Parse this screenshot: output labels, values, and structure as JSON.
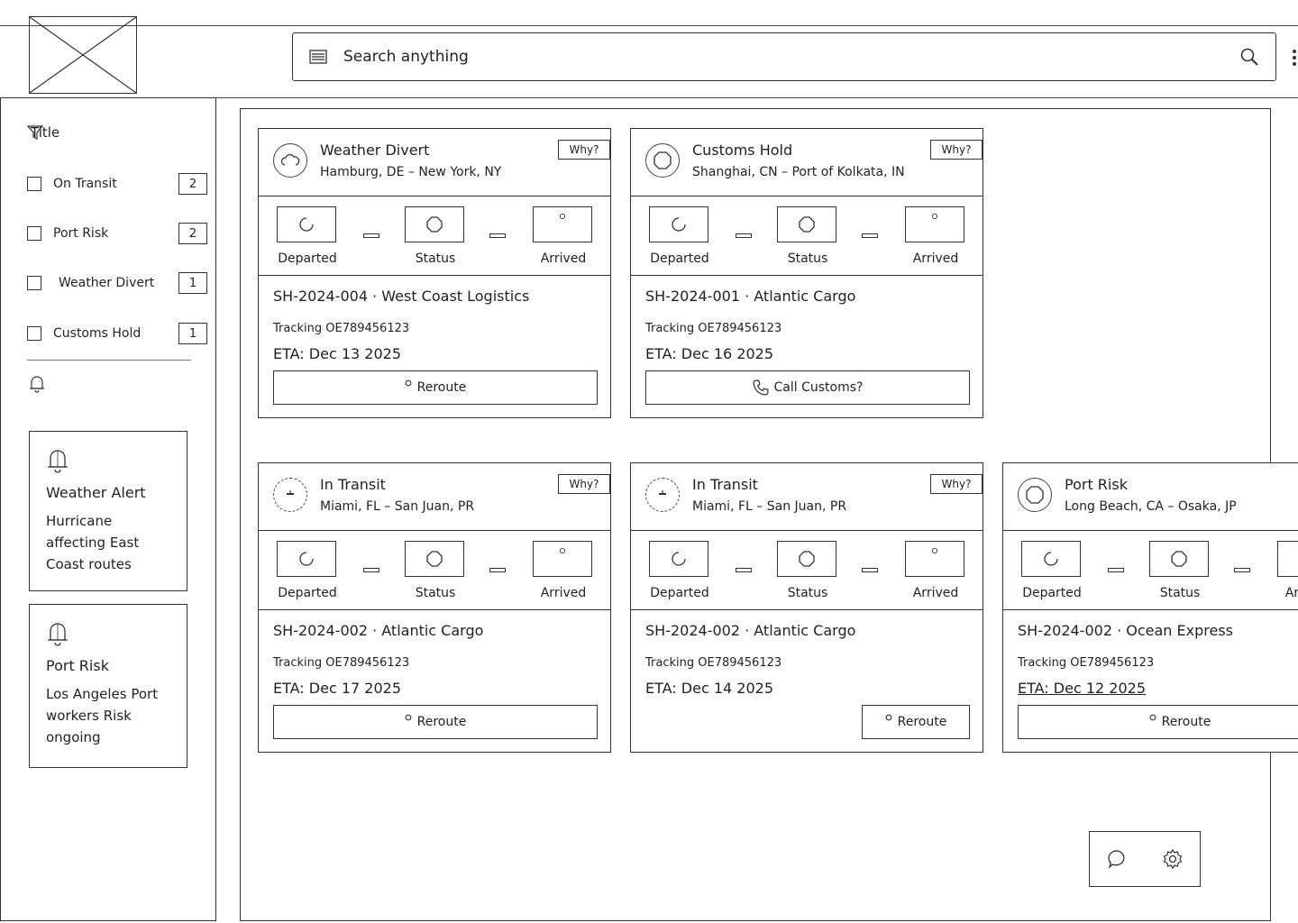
{
  "header": {
    "search_placeholder": "Search anything"
  },
  "sidebar": {
    "filter_title": "Title",
    "filters": [
      {
        "label": "On Transit",
        "count": "2"
      },
      {
        "label": "Port Risk",
        "count": "2"
      },
      {
        "label": "Weather Divert",
        "count": "1"
      },
      {
        "label": "Customs Hold",
        "count": "1"
      }
    ],
    "alerts": [
      {
        "title": "Weather Alert",
        "body": "Hurricane affecting East Coast routes"
      },
      {
        "title": "Port Risk",
        "body": "Los Angeles Port workers Risk ongoing"
      }
    ]
  },
  "step_labels": {
    "departed": "Departed",
    "status": "Status",
    "arrived": "Arrived"
  },
  "cards": [
    {
      "title": "Weather Divert",
      "route": "Hamburg, DE – New York, NY",
      "why": "Why?",
      "shipment": "SH-2024-004 · West Coast Logistics",
      "tracking": "Tracking OE789456123",
      "eta": "ETA: Dec 13 2025",
      "action": "Reroute",
      "icon": "cloud-icon"
    },
    {
      "title": "Customs Hold",
      "route": "Shanghai, CN – Port of Kolkata, IN",
      "why": "Why?",
      "shipment": "SH-2024-001 · Atlantic Cargo",
      "tracking": "Tracking OE789456123",
      "eta": "ETA: Dec 16 2025",
      "action": "Call Customs?",
      "icon": "octagon-icon"
    },
    {
      "title": "In Transit",
      "route": "Miami, FL – San Juan, PR",
      "why": "Why?",
      "shipment": "SH-2024-002 · Atlantic Cargo",
      "tracking": "Tracking OE789456123",
      "eta": "ETA: Dec 17 2025",
      "action": "Reroute",
      "icon": "ship-icon"
    },
    {
      "title": "In Transit",
      "route": "Miami, FL – San Juan, PR",
      "why": "Why?",
      "shipment": "SH-2024-002 · Atlantic Cargo",
      "tracking": "Tracking OE789456123",
      "eta": "ETA: Dec 14 2025",
      "action": "Reroute",
      "icon": "ship-icon"
    },
    {
      "title": "Port Risk",
      "route": "Long Beach, CA – Osaka, JP",
      "why": "",
      "shipment": "SH-2024-002 · Ocean Express",
      "tracking": "Tracking OE789456123",
      "eta": "ETA: Dec 12 2025",
      "action": "Reroute",
      "icon": "octagon-icon"
    }
  ]
}
